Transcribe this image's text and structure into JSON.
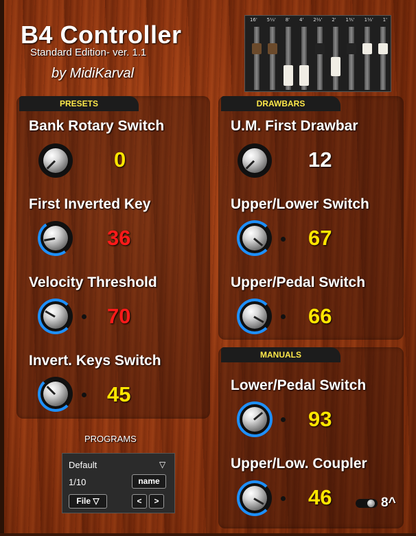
{
  "header": {
    "title": "B4 Controller",
    "subtitle": "Standard Edition- ver. 1.1",
    "byline": "by MidiKarval"
  },
  "drawbar_image": {
    "footages": [
      "16'",
      "5⅓'",
      "8'",
      "4'",
      "2⅔'",
      "2'",
      "1⅗'",
      "1⅓'",
      "1'"
    ]
  },
  "presets": {
    "tab": "PRESETS",
    "controls": [
      {
        "label": "Bank Rotary Switch",
        "value": "0",
        "color": "#ffe600"
      },
      {
        "label": "First Inverted Key",
        "value": "36",
        "color": "#ff1a1a"
      },
      {
        "label": "Velocity Threshold",
        "value": "70",
        "color": "#ff1a1a"
      },
      {
        "label": "Invert. Keys Switch",
        "value": "45",
        "color": "#ffe600"
      }
    ]
  },
  "drawbars": {
    "tab": "DRAWBARS",
    "controls": [
      {
        "label": "U.M. First Drawbar",
        "value": "12",
        "color": "#ffffff"
      },
      {
        "label": "Upper/Lower Switch",
        "value": "67",
        "color": "#ffe600"
      },
      {
        "label": "Upper/Pedal Switch",
        "value": "66",
        "color": "#ffe600"
      }
    ]
  },
  "manuals": {
    "tab": "MANUALS",
    "controls": [
      {
        "label": "Lower/Pedal Switch",
        "value": "93",
        "color": "#ffe600"
      },
      {
        "label": "Upper/Low. Coupler",
        "value": "46",
        "color": "#ffe600"
      }
    ],
    "toggle_label": "8^"
  },
  "programs": {
    "title": "PROGRAMS",
    "selected": "Default",
    "dropdown_icon": "▽",
    "position": "1/10",
    "name_button": "name",
    "file_button": "File ▽",
    "prev_button": "<",
    "next_button": ">"
  },
  "colors": {
    "accent_blue": "#1e90ff",
    "tab_text": "#ffe94a"
  }
}
